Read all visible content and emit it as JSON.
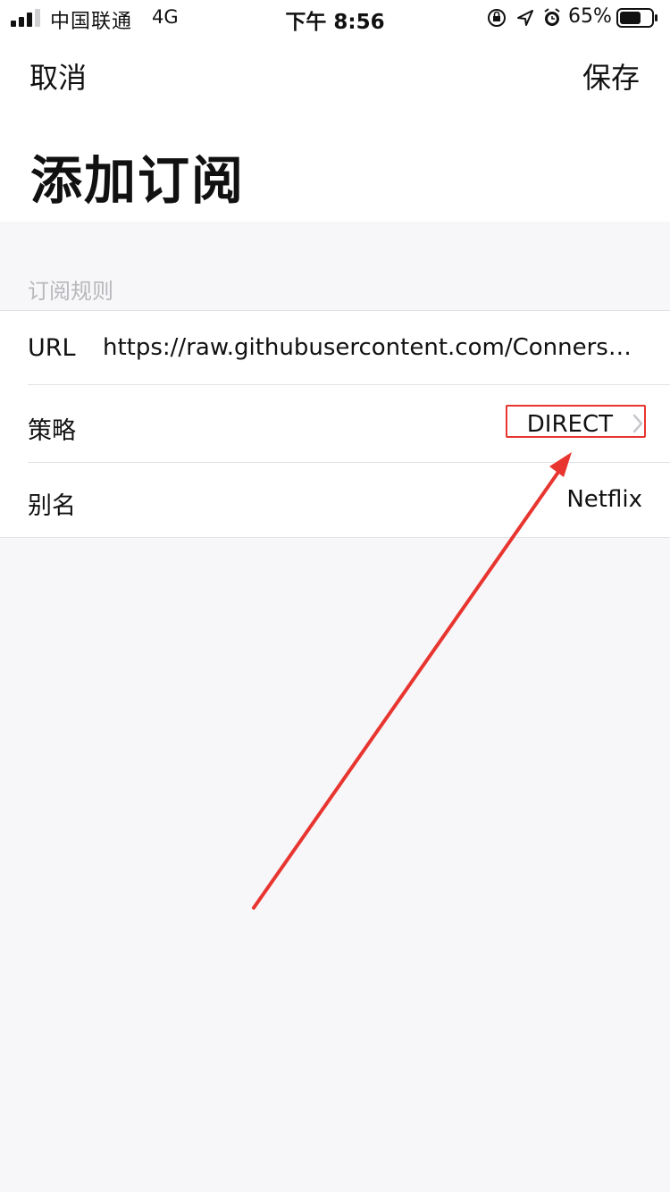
{
  "status_bar": {
    "carrier": "中国联通",
    "network": "4G",
    "time": "下午 8:56",
    "battery_percent": "65%",
    "icons": [
      "signal-icon",
      "rotation-lock-icon",
      "location-icon",
      "alarm-icon",
      "battery-icon"
    ]
  },
  "nav": {
    "cancel_label": "取消",
    "save_label": "保存",
    "title": "添加订阅"
  },
  "section": {
    "header": "订阅规则",
    "rows": [
      {
        "label": "URL",
        "value": "https://raw.githubusercontent.com/ConnersH..."
      },
      {
        "label": "策略",
        "value": "DIRECT"
      },
      {
        "label": "别名",
        "value": "Netflix"
      }
    ]
  },
  "colors": {
    "background": "#f7f7f9",
    "annotation_red": "#e83530",
    "secondary_text": "#b8b8bc"
  }
}
